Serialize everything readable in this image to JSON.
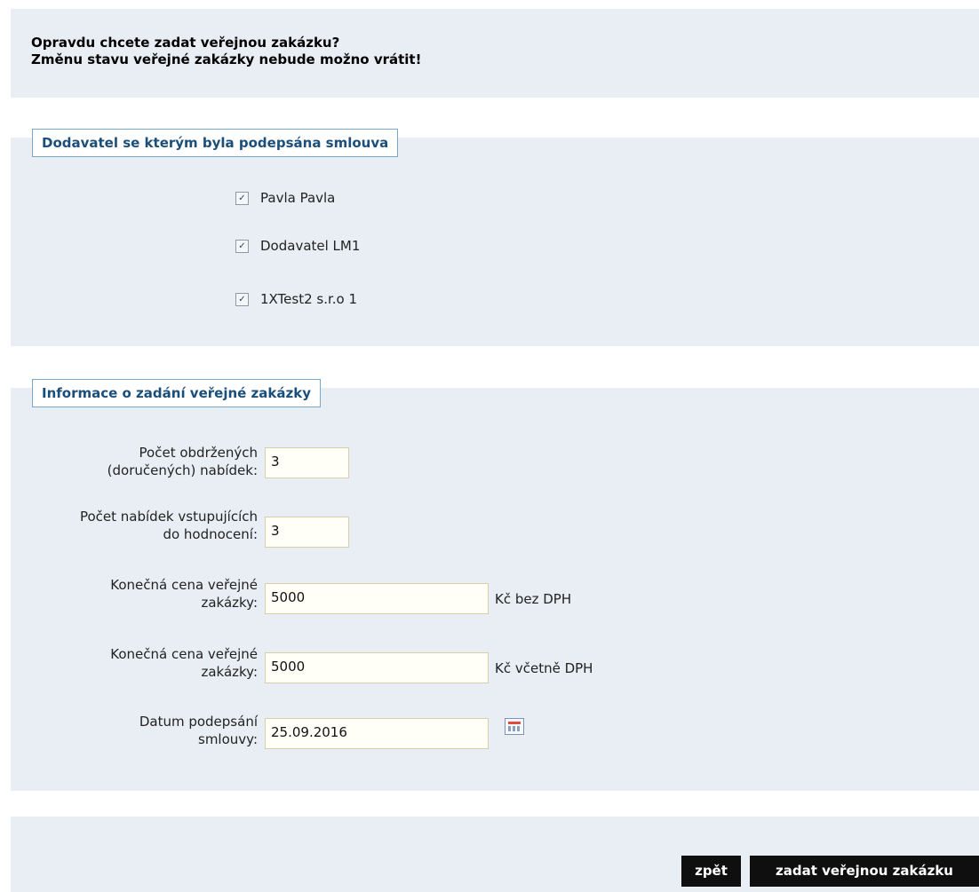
{
  "confirm": {
    "line1": "Opravdu chcete zadat veřejnou zakázku?",
    "line2": "Změnu stavu veřejné zakázky nebude možno vrátit!"
  },
  "supplier_section": {
    "legend": "Dodavatel se kterým byla podepsána smlouva",
    "suppliers": [
      {
        "label": "Pavla Pavla",
        "checked": true
      },
      {
        "label": "Dodavatel LM1",
        "checked": true
      },
      {
        "label": "1XTest2 s.r.o 1",
        "checked": true
      }
    ]
  },
  "info_section": {
    "legend": "Informace o zadání veřejné zakázky",
    "fields": [
      {
        "label_line1": "Počet obdržených",
        "label_line2": "(doručených) nabídek:",
        "value": "3"
      },
      {
        "label_line1": "Počet nabídek vstupujících",
        "label_line2": "do hodnocení:",
        "value": "3"
      },
      {
        "label_line1": "Konečná cena veřejné",
        "label_line2": "zakázky:",
        "value": "5000",
        "unit": "Kč bez DPH"
      },
      {
        "label_line1": "Konečná cena veřejné",
        "label_line2": "zakázky:",
        "value": "5000",
        "unit": "Kč včetně DPH"
      },
      {
        "label_line1": "Datum podepsání",
        "label_line2": "smlouvy:",
        "value": "25.09.2016",
        "icon": "calendar-icon"
      }
    ]
  },
  "actions": {
    "back_label": "zpět",
    "submit_label": "zadat veřejnou zakázku"
  }
}
